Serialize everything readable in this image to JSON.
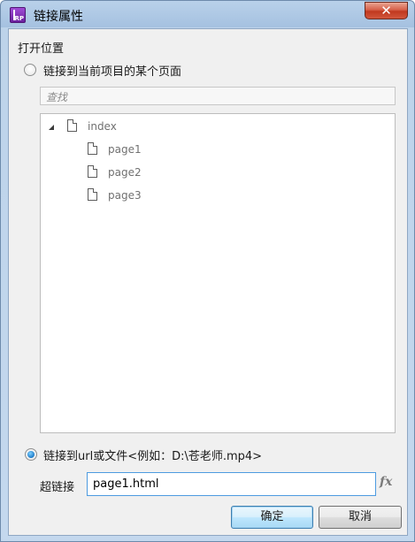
{
  "window": {
    "title": "链接属性",
    "app_icon_text": "RP",
    "close_glyph": "✕"
  },
  "open_position": {
    "section_label": "打开位置",
    "page_option_label": "链接到当前项目的某个页面",
    "page_option_selected": false,
    "search_placeholder": "查找",
    "tree": {
      "root": {
        "label": "index",
        "expanded": true
      },
      "children": [
        {
          "label": "page1"
        },
        {
          "label": "page2"
        },
        {
          "label": "page3"
        }
      ]
    },
    "url_option_label": "链接到url或文件<例如：D:\\苍老师.mp4>",
    "url_option_selected": true
  },
  "hyperlink": {
    "label": "超链接",
    "value": "page1.html",
    "fx_label": "fx"
  },
  "buttons": {
    "ok": "确定",
    "cancel": "取消"
  },
  "icons": {
    "app": "axure-rp-icon",
    "close": "close-icon",
    "tree_toggle": "expand-triangle-icon",
    "page": "page-icon",
    "formula": "fx-icon"
  }
}
